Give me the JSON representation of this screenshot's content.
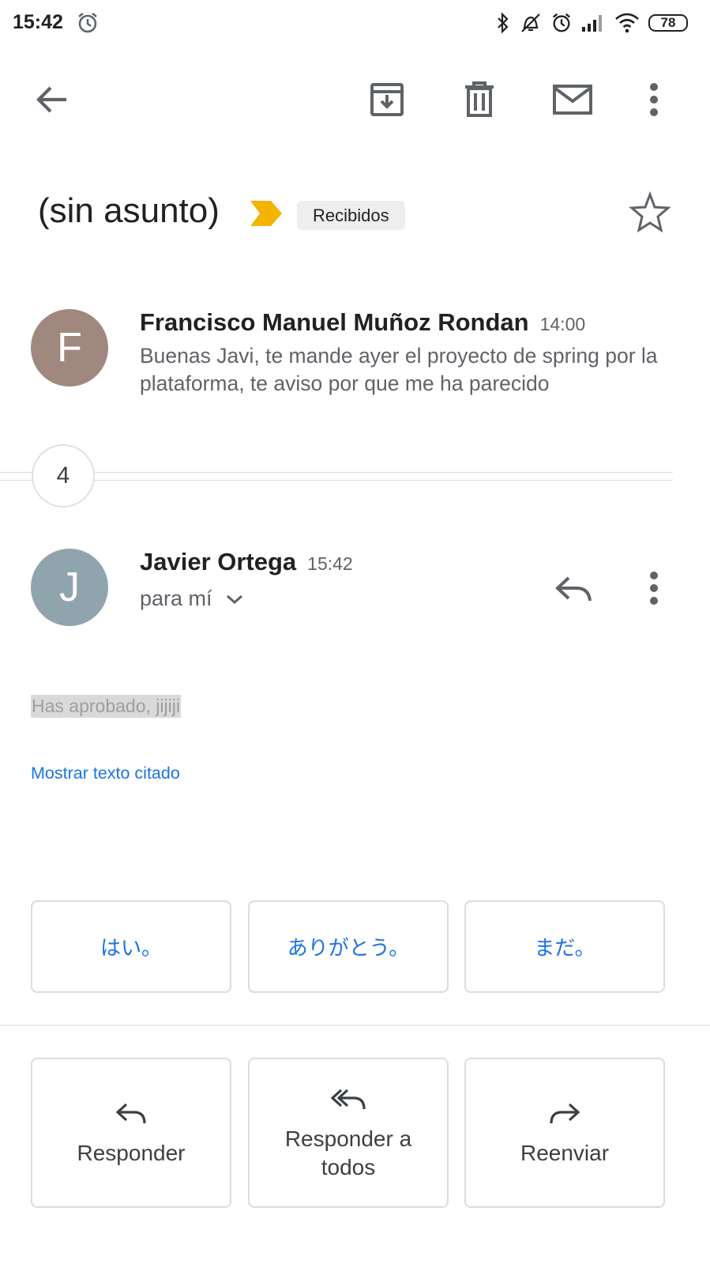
{
  "status_bar": {
    "time": "15:42",
    "battery": "78",
    "icons": [
      "alarm-icon",
      "bluetooth-icon",
      "mute-icon",
      "alarm-icon",
      "signal-icon",
      "wifi-icon",
      "battery-icon"
    ]
  },
  "toolbar": {
    "icons": [
      "back-arrow-icon",
      "archive-icon",
      "delete-icon",
      "mail-icon",
      "more-vert-icon"
    ]
  },
  "subject": {
    "title": "(sin asunto)",
    "label": "Recibidos",
    "important_color": "#f4b400"
  },
  "messages": [
    {
      "avatar_letter": "F",
      "avatar_color": "#a1887f",
      "sender": "Francisco Manuel Muñoz Rondan",
      "time": "14:00",
      "snippet": "Buenas Javi, te mande ayer el proyecto de spring por la plataforma, te aviso por que me ha parecido"
    },
    {
      "avatar_letter": "J",
      "avatar_color": "#90a4ae",
      "sender": "Javier Ortega",
      "time": "15:42",
      "to": "para mí",
      "body": "Has aprobado, jijiji",
      "show_quoted": "Mostrar texto citado"
    }
  ],
  "collapsed_count": "4",
  "smart_replies": [
    "はい。",
    "ありがとう。",
    "まだ。"
  ],
  "actions": {
    "reply": "Responder",
    "reply_all": "Responder a todos",
    "forward": "Reenviar"
  },
  "colors": {
    "link": "#1a73e8",
    "text_secondary": "#5f6368"
  }
}
